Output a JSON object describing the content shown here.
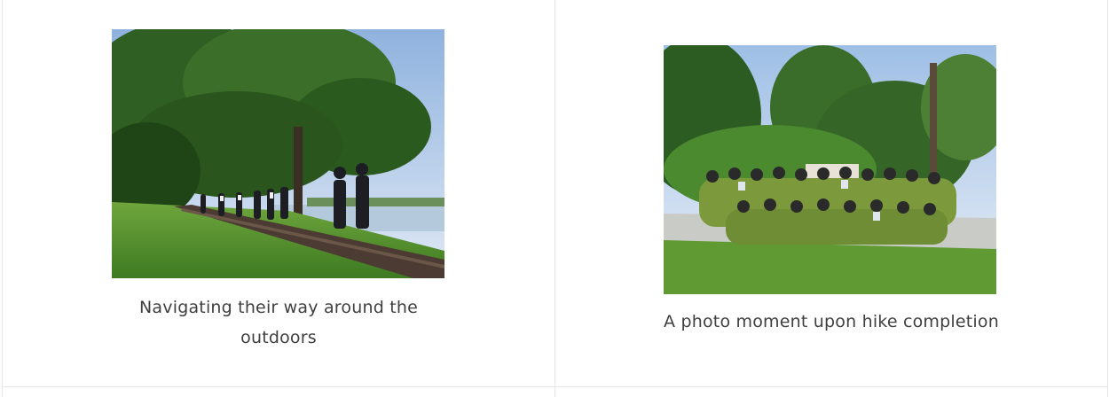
{
  "gallery": {
    "items": [
      {
        "image_alt": "Navigating their way around the outdoors",
        "caption_lines": [
          "Navigating their way around the",
          "outdoors"
        ]
      },
      {
        "image_alt": "A photo moment upon hike completion",
        "caption_lines": [
          "A photo moment upon hike completion"
        ]
      }
    ]
  },
  "colors": {
    "caption_text": "#3f3f3f",
    "cell_border": "#e6e6e6",
    "foliage": "#3e7d2a",
    "grass": "#5f9a32",
    "sky": "#b9d2ec",
    "boardwalk": "#4b3b33",
    "shirts": "#7c9a3c"
  }
}
